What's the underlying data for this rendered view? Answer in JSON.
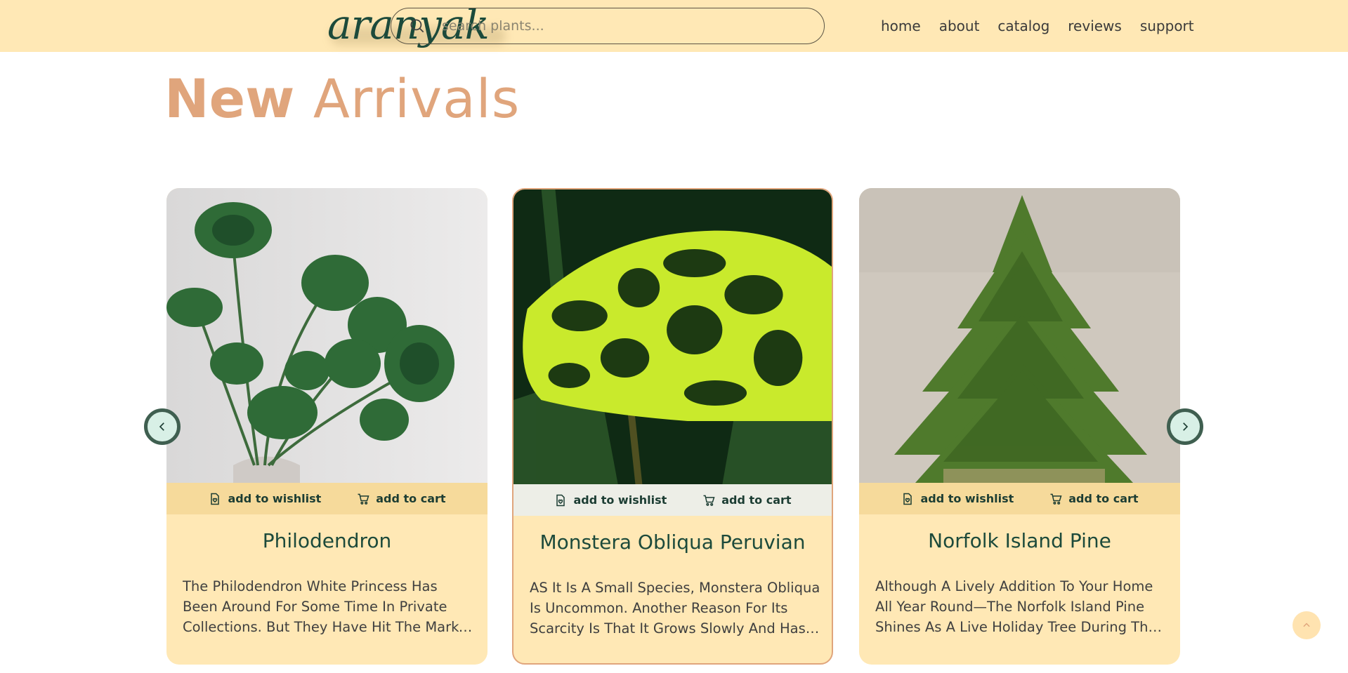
{
  "header": {
    "logo_text": "aranyak",
    "search": {
      "placeholder": "search plants..."
    },
    "nav": [
      "home",
      "about",
      "catalog",
      "reviews",
      "support"
    ]
  },
  "page": {
    "title_bold": "New",
    "title_light": "Arrivals"
  },
  "actions": {
    "wishlist_label": "add to wishlist",
    "cart_label": "add to cart"
  },
  "cards": [
    {
      "name": "Philodendron",
      "description": "The Philodendron White Princess Has Been Around For Some Time In Private Collections. But They Have Hit The Market Recently."
    },
    {
      "name": "Monstera Obliqua Peruvian",
      "description": "AS It Is A Small Species, Monstera Obliqua Is Uncommon. Another Reason For Its Scarcity Is That It Grows Slowly And Has Short Internodes."
    },
    {
      "name": "Norfolk Island Pine",
      "description": "Although A Lively Addition To Your Home All Year Round—The Norfolk Island Pine Shines As A Live Holiday Tree During The Winter Season."
    }
  ],
  "colors": {
    "header_bg": "#ffe8b5",
    "accent": "#e0a57c",
    "text_dark_green": "#1c4a3b",
    "card_bg": "#ffe8b5"
  },
  "icons": [
    "search-icon",
    "wishlist-icon",
    "cart-icon",
    "chevron-left-icon",
    "chevron-right-icon",
    "chevron-up-icon"
  ]
}
